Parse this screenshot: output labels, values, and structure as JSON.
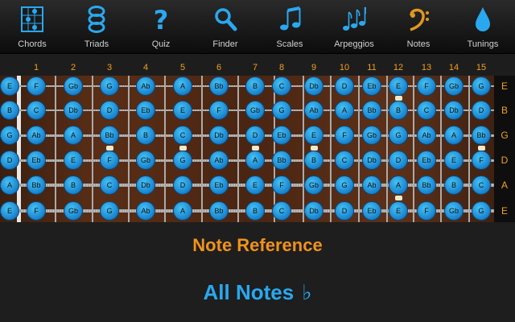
{
  "toolbar": [
    {
      "icon": "chord-diagram-icon",
      "label": "Chords"
    },
    {
      "icon": "triad-notes-icon",
      "label": "Triads"
    },
    {
      "icon": "question-mark-icon",
      "label": "Quiz"
    },
    {
      "icon": "magnifier-icon",
      "label": "Finder"
    },
    {
      "icon": "beamed-notes-icon",
      "label": "Scales"
    },
    {
      "icon": "triple-notes-icon",
      "label": "Arpeggios"
    },
    {
      "icon": "bass-clef-icon",
      "label": "Notes"
    },
    {
      "icon": "water-drop-icon",
      "label": "Tunings"
    }
  ],
  "fret_numbers": [
    "1",
    "2",
    "3",
    "4",
    "5",
    "6",
    "7",
    "8",
    "9",
    "10",
    "11",
    "12",
    "13",
    "14",
    "15"
  ],
  "string_names": [
    "E",
    "B",
    "G",
    "D",
    "A",
    "E"
  ],
  "inlay_frets": [
    3,
    5,
    7,
    9,
    12,
    15
  ],
  "fretboard_rows": [
    [
      "E",
      "F",
      "Gb",
      "G",
      "Ab",
      "A",
      "Bb",
      "B",
      "C",
      "Db",
      "D",
      "Eb",
      "E",
      "F",
      "Gb",
      "G"
    ],
    [
      "B",
      "C",
      "Db",
      "D",
      "Eb",
      "E",
      "F",
      "Gb",
      "G",
      "Ab",
      "A",
      "Bb",
      "B",
      "C",
      "Db",
      "D"
    ],
    [
      "G",
      "Ab",
      "A",
      "Bb",
      "B",
      "C",
      "Db",
      "D",
      "Eb",
      "E",
      "F",
      "Gb",
      "G",
      "Ab",
      "A",
      "Bb"
    ],
    [
      "D",
      "Eb",
      "E",
      "F",
      "Gb",
      "G",
      "Ab",
      "A",
      "Bb",
      "B",
      "C",
      "Db",
      "D",
      "Eb",
      "E",
      "F"
    ],
    [
      "A",
      "Bb",
      "B",
      "C",
      "Db",
      "D",
      "Eb",
      "E",
      "F",
      "Gb",
      "G",
      "Ab",
      "A",
      "Bb",
      "B",
      "C"
    ],
    [
      "E",
      "F",
      "Gb",
      "G",
      "Ab",
      "A",
      "Bb",
      "B",
      "C",
      "Db",
      "D",
      "Eb",
      "E",
      "F",
      "Gb",
      "G"
    ]
  ],
  "subtitle": "Note Reference",
  "main_title": "All Notes",
  "accidental_toggle": "♭",
  "colors": {
    "accent_orange": "#f0921c",
    "accent_blue": "#2aa8ef",
    "note_blue": "#1b86cf"
  }
}
